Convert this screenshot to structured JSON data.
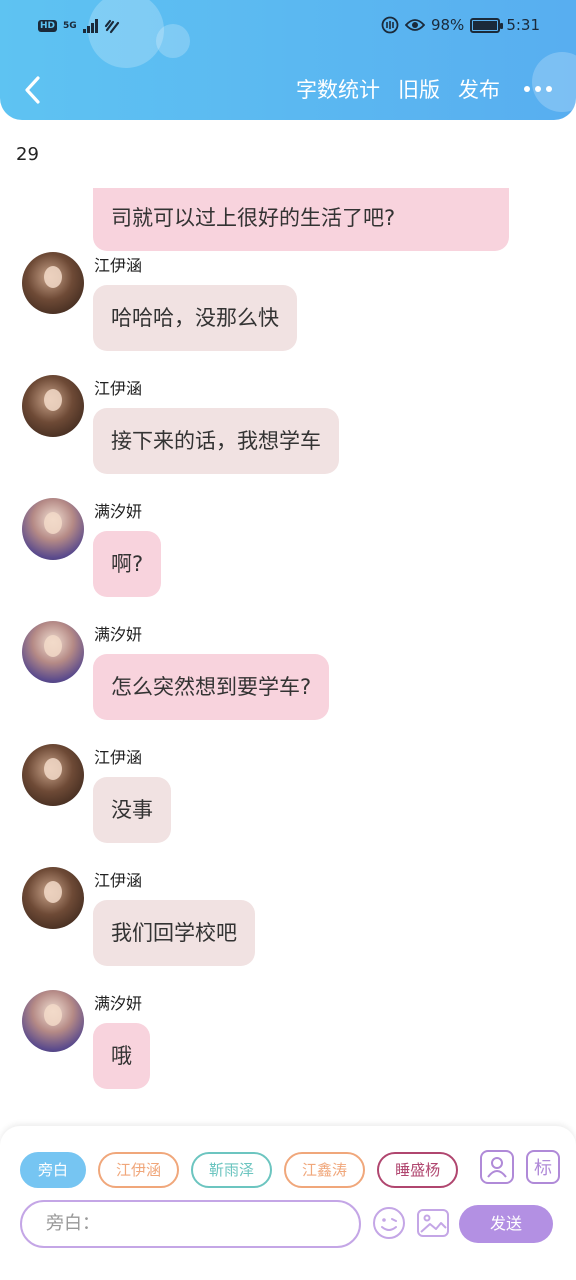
{
  "status_bar": {
    "left_badges": [
      "HD",
      "5G"
    ],
    "battery_percent": "98%",
    "battery_level": 0.98,
    "time": "5:31"
  },
  "header": {
    "back_icon": "chevron-left-icon",
    "actions": {
      "word_count": "字数统计",
      "old_version": "旧版",
      "publish": "发布"
    },
    "more_icon": "more-dots-icon"
  },
  "chapter_count": "29",
  "messages": [
    {
      "type": "continuation",
      "bubble": "pink",
      "text": "司就可以过上很好的生活了吧?"
    },
    {
      "speaker": "江伊涵",
      "avatar": "a",
      "bubble": "gray",
      "text": "哈哈哈，没那么快"
    },
    {
      "speaker": "江伊涵",
      "avatar": "a",
      "bubble": "gray",
      "text": "接下来的话，我想学车"
    },
    {
      "speaker": "满汐妍",
      "avatar": "b",
      "bubble": "pink",
      "text": "啊?"
    },
    {
      "speaker": "满汐妍",
      "avatar": "b",
      "bubble": "pink",
      "text": "怎么突然想到要学车?"
    },
    {
      "speaker": "江伊涵",
      "avatar": "a",
      "bubble": "gray",
      "text": "没事"
    },
    {
      "speaker": "江伊涵",
      "avatar": "a",
      "bubble": "gray",
      "text": "我们回学校吧"
    },
    {
      "speaker": "满汐妍",
      "avatar": "b",
      "bubble": "pink",
      "text": "哦"
    }
  ],
  "composer": {
    "chips": [
      {
        "label": "旁白",
        "active": true,
        "color": "#76c5f2"
      },
      {
        "label": "江伊涵",
        "active": false,
        "color": "#f0a77b"
      },
      {
        "label": "靳雨泽",
        "active": false,
        "color": "#6cc5c0"
      },
      {
        "label": "江鑫涛",
        "active": false,
        "color": "#f0a77b"
      },
      {
        "label": "睡盛杨",
        "active": false,
        "color": "#b0466f"
      }
    ],
    "role_icon": "person-card-icon",
    "mark_icon_label": "标",
    "input_placeholder": "旁白：",
    "emoji_icon": "smiley-icon",
    "image_icon": "image-icon",
    "send_label": "发送"
  },
  "colors": {
    "header_gradient_start": "#5ec3f2",
    "header_gradient_end": "#58aef0",
    "bubble_pink": "#f8d3dd",
    "bubble_gray": "#f1e2e2",
    "accent_purple": "#b390e3"
  }
}
